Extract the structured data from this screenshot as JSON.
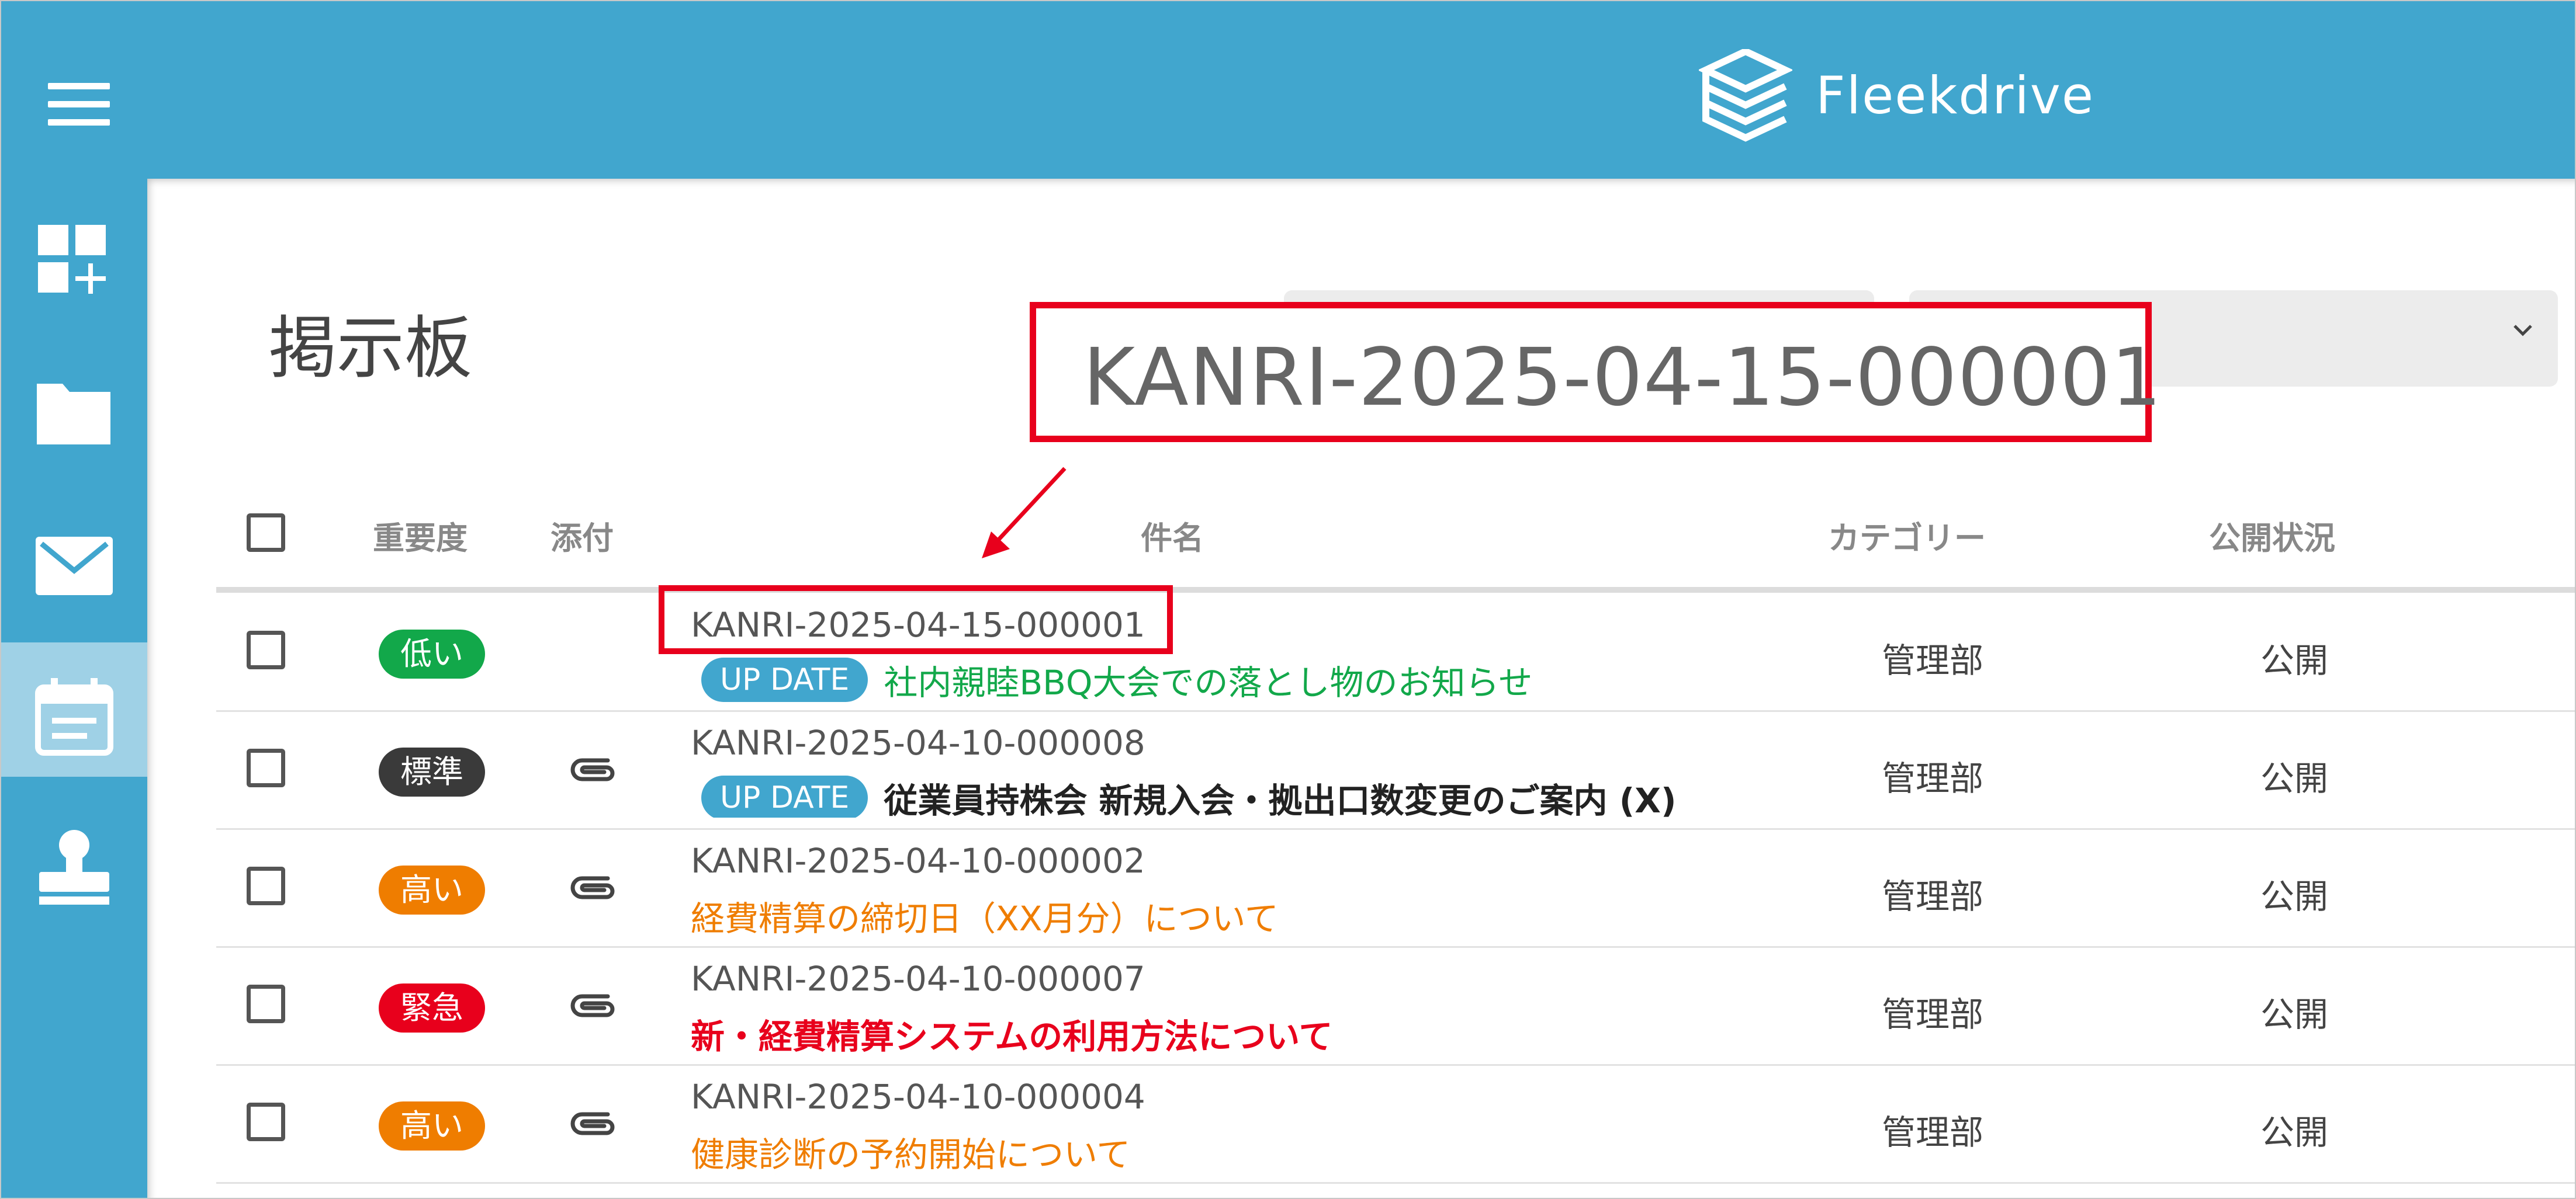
{
  "app": {
    "brand": "Fleekdrive",
    "colors": {
      "header": "#41a6ce",
      "sidebar_active": "#9fd1e6",
      "callout": "#e8001c"
    }
  },
  "sidebar": {
    "items": [
      {
        "name": "dashboard-add",
        "icon": "grid-plus-icon"
      },
      {
        "name": "folder",
        "icon": "folder-icon"
      },
      {
        "name": "mail",
        "icon": "envelope-icon"
      },
      {
        "name": "bulletin-board",
        "icon": "calendar-board-icon",
        "active": true
      },
      {
        "name": "approval",
        "icon": "stamp-icon"
      }
    ]
  },
  "page": {
    "title": "掲示板"
  },
  "callout": {
    "text": "KANRI-2025-04-15-000001"
  },
  "table": {
    "headers": {
      "priority": "重要度",
      "attachment": "添付",
      "subject": "件名",
      "category": "カテゴリー",
      "status": "公開状況"
    },
    "rows": [
      {
        "priority": "低い",
        "priority_color": "#12a84a",
        "attachment": false,
        "id": "KANRI-2025-04-15-000001",
        "update_label": "UP DATE",
        "subject": "社内親睦BBQ大会での落とし物のお知らせ",
        "subject_color": "#12a84a",
        "subject_bold": false,
        "category": "管理部",
        "status": "公開"
      },
      {
        "priority": "標準",
        "priority_color": "#3a3a3a",
        "attachment": true,
        "id": "KANRI-2025-04-10-000008",
        "update_label": "UP DATE",
        "subject": "従業員持株会 新規入会・拠出口数変更のご案内 (X)",
        "subject_color": "#222222",
        "subject_bold": true,
        "category": "管理部",
        "status": "公開"
      },
      {
        "priority": "高い",
        "priority_color": "#ef7d00",
        "attachment": true,
        "id": "KANRI-2025-04-10-000002",
        "update_label": "",
        "subject": "経費精算の締切日（XX月分）について",
        "subject_color": "#ef7d00",
        "subject_bold": false,
        "category": "管理部",
        "status": "公開"
      },
      {
        "priority": "緊急",
        "priority_color": "#e8001c",
        "attachment": true,
        "id": "KANRI-2025-04-10-000007",
        "update_label": "",
        "subject": "新・経費精算システムの利用方法について",
        "subject_color": "#e8001c",
        "subject_bold": true,
        "category": "管理部",
        "status": "公開"
      },
      {
        "priority": "高い",
        "priority_color": "#ef7d00",
        "attachment": true,
        "id": "KANRI-2025-04-10-000004",
        "update_label": "",
        "subject": "健康診断の予約開始について",
        "subject_color": "#ef7d00",
        "subject_bold": false,
        "category": "管理部",
        "status": "公開"
      }
    ]
  }
}
